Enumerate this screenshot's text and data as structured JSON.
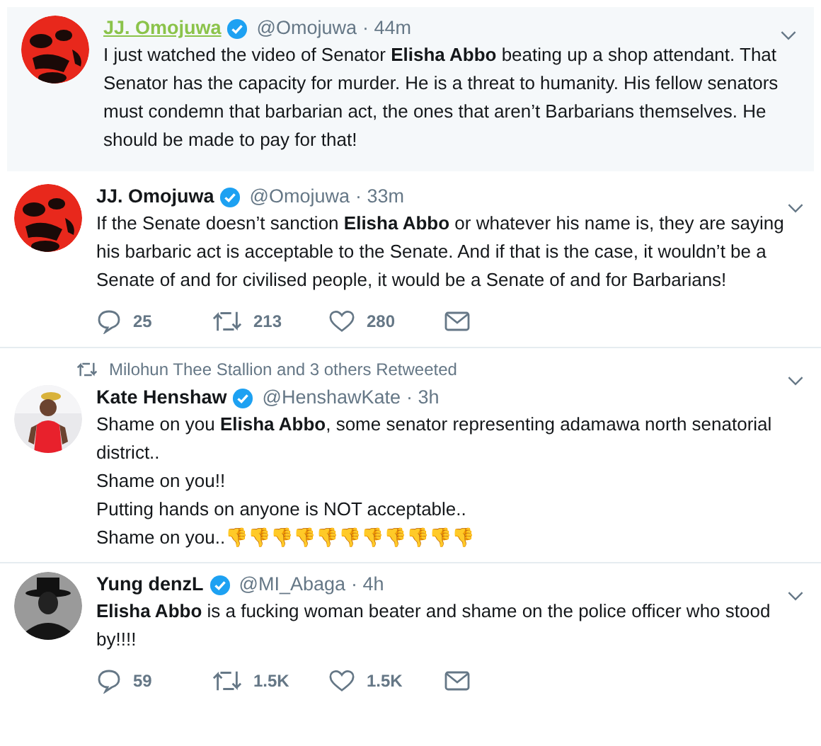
{
  "tweets": [
    {
      "highlighted": true,
      "name": "JJ. Omojuwa",
      "name_hovered": true,
      "verified": true,
      "handle": "@Omojuwa",
      "time": "· 44m",
      "text": "I just watched the video of Senator **Elisha Abbo** beating up a shop attendant. That Senator has the capacity for murder. He is a threat to humanity. His fellow senators must condemn that barbarian act, the ones that aren’t Barbarians themselves. He should be made to pay for that!"
    },
    {
      "highlighted": false,
      "name": "JJ. Omojuwa",
      "name_hovered": false,
      "verified": true,
      "handle": "@Omojuwa",
      "time": "· 33m",
      "text": "If the Senate doesn’t sanction **Elisha Abbo** or whatever his name is, they are saying his barbaric act is acceptable to the Senate. And if that is the case, it wouldn’t be a Senate of and for civilised people, it would be a Senate of and for Barbarians!",
      "actions": {
        "replies": "25",
        "retweets": "213",
        "likes": "280"
      }
    },
    {
      "highlighted": false,
      "retweeted_by": "Milohun Thee Stallion and 3 others Retweeted",
      "name": "Kate Henshaw",
      "name_hovered": false,
      "verified": true,
      "handle": "@HenshawKate",
      "time": "· 3h",
      "text": "Shame on you **Elisha Abbo**, some senator representing adamawa north senatorial district..",
      "extra_lines": [
        "Shame on you!!",
        "Putting hands on anyone is NOT acceptable..",
        "Shame on you..👎👎👎👎👎👎👎👎👎👎👎"
      ]
    },
    {
      "highlighted": false,
      "name": "Yung denzL",
      "name_hovered": false,
      "verified": true,
      "handle": "@MI_Abaga",
      "time": "· 4h",
      "text": "**Elisha Abbo** is a fucking woman beater and shame on the police officer who stood by!!!!",
      "actions": {
        "replies": "59",
        "retweets": "1.5K",
        "likes": "1.5K"
      }
    }
  ]
}
